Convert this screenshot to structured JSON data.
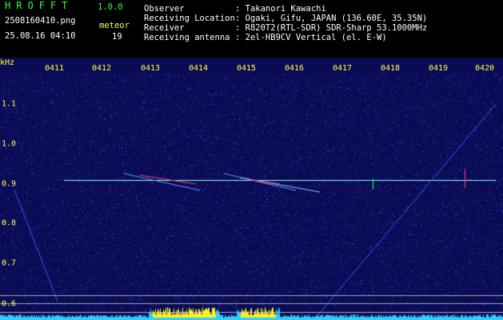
{
  "app": {
    "title": "HROFFT",
    "version": "1.0.0"
  },
  "file": {
    "name": "2508160410.png",
    "datetime": "25.08.16 04:10"
  },
  "meteor": {
    "label": "meteor",
    "count": "19"
  },
  "info": [
    {
      "label": "Observer",
      "value": ": Takanori Kawachi"
    },
    {
      "label": "Receiving Location",
      "value": ": Ogaki, Gifu, JAPAN (136.60E, 35.35N)"
    },
    {
      "label": "Receiver",
      "value": ": R820T2(RTL-SDR) SDR-Sharp 53.1000MHz"
    },
    {
      "label": "Receiving antenna",
      "value": ": 2el-HB9CV Vertical (el. E-W)"
    }
  ],
  "colors": {
    "background": "#000000",
    "plot_background": "#0b0b55",
    "text_yellow": "#ffff44",
    "text_green": "#33ff33",
    "text_white": "#ffffff"
  },
  "axis": {
    "y_unit": "kHz",
    "x_ticks": [
      "0411",
      "0412",
      "0413",
      "0414",
      "0415",
      "0416",
      "0417",
      "0418",
      "0419",
      "0420"
    ],
    "y_ticks": [
      "1.1",
      "1.0",
      "0.9",
      "0.8",
      "0.7",
      "0.6"
    ]
  },
  "chart_data": {
    "type": "heatmap",
    "xlabel": "",
    "ylabel": "kHz",
    "x_range_minutes": [
      "0410",
      "0420"
    ],
    "y_range_khz": [
      0.57,
      1.15
    ],
    "carrier_khz": 0.908,
    "meteor_count": 19
  }
}
